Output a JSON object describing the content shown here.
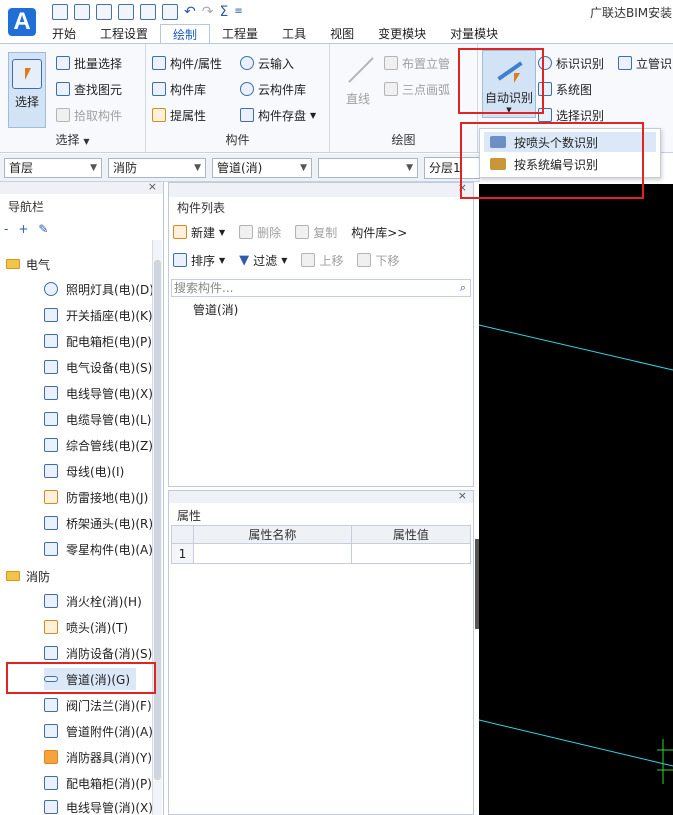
{
  "app": {
    "logo_letter": "A",
    "title": "广联达BIM安装"
  },
  "quick_access": {
    "sigma": "Σ",
    "more": "≡"
  },
  "menu": {
    "tabs": [
      {
        "label": "开始"
      },
      {
        "label": "工程设置"
      },
      {
        "label": "绘制"
      },
      {
        "label": "工程量"
      },
      {
        "label": "工具"
      },
      {
        "label": "视图"
      },
      {
        "label": "变更模块"
      },
      {
        "label": "对量模块"
      }
    ]
  },
  "ribbon": {
    "select_group": {
      "label": "选择",
      "select_button": "选择",
      "batch_select": "批量选择",
      "find_element": "查找图元",
      "pick_component": "拾取构件"
    },
    "component_group": {
      "label": "构件",
      "component_properties": "构件/属性",
      "component_library": "构件库",
      "extract_properties": "提属性",
      "cloud_input": "云输入",
      "cloud_library": "云构件库",
      "component_save": "构件存盘"
    },
    "draw_group": {
      "label": "绘图",
      "line": "直线",
      "place_riser": "布置立管",
      "three_point_arc": "三点画弧"
    },
    "recognize_group": {
      "auto_recognize": "自动识别",
      "mark_recognize": "标识识别",
      "riser_recognize": "立管识",
      "system_diagram": "系统图",
      "select_recognize": "选择识别"
    }
  },
  "auto_dropdown": {
    "items": [
      {
        "label": "按喷头个数识别"
      },
      {
        "label": "按系统编号识别"
      }
    ]
  },
  "combos": {
    "floor": "首层",
    "discipline": "消防",
    "type": "管道(消)",
    "component": "",
    "layer": "分层1"
  },
  "nav": {
    "title": "导航栏",
    "close": "×",
    "tools": {
      "collapse": "-",
      "expand": "+"
    },
    "electrical": {
      "label": "电气",
      "items": [
        {
          "label": "照明灯具(电)(D)"
        },
        {
          "label": "开关插座(电)(K)"
        },
        {
          "label": "配电箱柜(电)(P)"
        },
        {
          "label": "电气设备(电)(S)"
        },
        {
          "label": "电线导管(电)(X)"
        },
        {
          "label": "电缆导管(电)(L)"
        },
        {
          "label": "综合管线(电)(Z)"
        },
        {
          "label": "母线(电)(I)"
        },
        {
          "label": "防雷接地(电)(J)"
        },
        {
          "label": "桥架通头(电)(R)"
        },
        {
          "label": "零星构件(电)(A)"
        }
      ]
    },
    "fire": {
      "label": "消防",
      "items": [
        {
          "label": "消火栓(消)(H)"
        },
        {
          "label": "喷头(消)(T)"
        },
        {
          "label": "消防设备(消)(S)"
        },
        {
          "label": "管道(消)(G)"
        },
        {
          "label": "阀门法兰(消)(F)"
        },
        {
          "label": "管道附件(消)(A)"
        },
        {
          "label": "消防器具(消)(Y)"
        },
        {
          "label": "配电箱柜(消)(P)"
        },
        {
          "label": "电线导管(消)(X)"
        }
      ]
    }
  },
  "component_list": {
    "title": "构件列表",
    "close": "×",
    "toolbar1": {
      "new": "新建",
      "delete": "删除",
      "copy": "复制",
      "library": "构件库>>"
    },
    "toolbar2": {
      "sort": "排序",
      "filter": "过滤",
      "move_up": "上移",
      "move_down": "下移"
    },
    "search_placeholder": "搜索构件...",
    "search_icon": "⌕",
    "items": [
      {
        "label": "管道(消)"
      }
    ]
  },
  "properties": {
    "title": "属性",
    "close": "×",
    "columns": [
      "属性名称",
      "属性值"
    ],
    "rows": [
      {
        "index": "1",
        "name": "",
        "value": ""
      }
    ]
  },
  "colors": {
    "accent": "#1e5fb4",
    "highlight_red": "#e02424",
    "canvas_bg": "#000000",
    "canvas_line_cyan": "#33d6e6",
    "canvas_line_green": "#2fd82f"
  }
}
